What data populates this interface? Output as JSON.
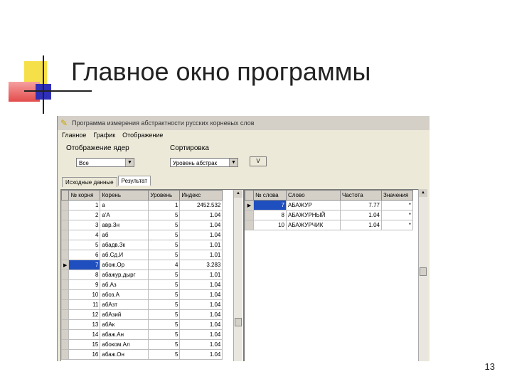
{
  "slide": {
    "title": "Главное окно программы",
    "page_number": "13"
  },
  "window": {
    "title": "Программа измерения абстрактности русских корневых слов",
    "menu": [
      "Главное",
      "График",
      "Отображение"
    ],
    "display_label": "Отображение ядер",
    "display_value": "Все",
    "sort_label": "Сортировка",
    "sort_value": "Уровень абстрак",
    "sort_button": "V",
    "tabs": [
      "Исходные данные",
      "Результат"
    ]
  },
  "roots_table": {
    "columns": [
      "№ корня",
      "Корень",
      "Уровень",
      "Индекс"
    ],
    "rows": [
      [
        "1",
        "а",
        "1",
        "2452.532"
      ],
      [
        "2",
        "а'А",
        "5",
        "1.04"
      ],
      [
        "3",
        "авр.Зн",
        "5",
        "1.04"
      ],
      [
        "4",
        "аб",
        "5",
        "1.04"
      ],
      [
        "5",
        "абадв.Зк",
        "5",
        "1.01"
      ],
      [
        "6",
        "аб.Сд.И",
        "5",
        "1.01"
      ],
      [
        "7",
        "абож.Ор",
        "4",
        "3.283"
      ],
      [
        "8",
        "абажур.дырг",
        "5",
        "1.01"
      ],
      [
        "9",
        "аб.Аз",
        "5",
        "1.04"
      ],
      [
        "10",
        "абоз.А",
        "5",
        "1.04"
      ],
      [
        "11",
        "абАзт",
        "5",
        "1.04"
      ],
      [
        "12",
        "абАзий",
        "5",
        "1.04"
      ],
      [
        "13",
        "абАк",
        "5",
        "1.04"
      ],
      [
        "14",
        "абаж.Ан",
        "5",
        "1.04"
      ],
      [
        "15",
        "абоком.Ал",
        "5",
        "1.04"
      ],
      [
        "16",
        "абаж.Он",
        "5",
        "1.04"
      ]
    ],
    "selected_row": 6
  },
  "words_table": {
    "columns": [
      "№ слова",
      "Слово",
      "Частота",
      "Значения"
    ],
    "rows": [
      [
        "7",
        "АБАЖУР",
        "7.77",
        "*"
      ],
      [
        "8",
        "АБАЖУРНЫЙ",
        "1.04",
        "*"
      ],
      [
        "10",
        "АБАЖУРЧИК",
        "1.04",
        "*"
      ]
    ],
    "selected_row": 0
  }
}
